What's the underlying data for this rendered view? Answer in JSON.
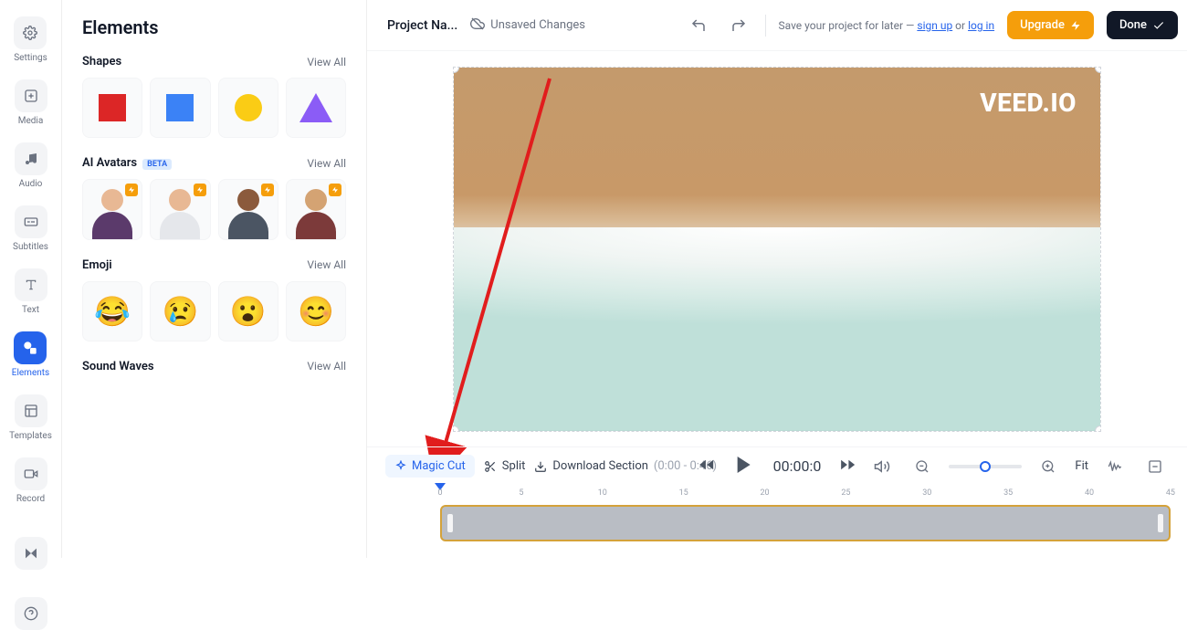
{
  "rail": {
    "items": [
      {
        "id": "settings",
        "label": "Settings"
      },
      {
        "id": "media",
        "label": "Media"
      },
      {
        "id": "audio",
        "label": "Audio"
      },
      {
        "id": "subtitles",
        "label": "Subtitles"
      },
      {
        "id": "text",
        "label": "Text"
      },
      {
        "id": "elements",
        "label": "Elements"
      },
      {
        "id": "templates",
        "label": "Templates"
      },
      {
        "id": "record",
        "label": "Record"
      }
    ]
  },
  "panel": {
    "title": "Elements",
    "view_all": "View All",
    "sections": {
      "shapes": {
        "title": "Shapes",
        "items": [
          {
            "id": "square",
            "color": "#dc2626"
          },
          {
            "id": "square2",
            "color": "#3b82f6"
          },
          {
            "id": "circle",
            "color": "#facc15"
          },
          {
            "id": "triangle",
            "color": "#8b5cf6"
          }
        ]
      },
      "avatars": {
        "title": "AI Avatars",
        "beta": "BETA",
        "items": [
          {
            "id": "avatar-1",
            "skin": "#e8b894",
            "shirt": "#5b3a6b",
            "bg": "#f3f4f6"
          },
          {
            "id": "avatar-2",
            "skin": "#e8b894",
            "shirt": "#e5e7eb",
            "bg": "#f3f4f6"
          },
          {
            "id": "avatar-3",
            "skin": "#8b5a3c",
            "shirt": "#4b5563",
            "bg": "#f3f4f6"
          },
          {
            "id": "avatar-4",
            "skin": "#d4a373",
            "shirt": "#7c3a3a",
            "bg": "#f3f4f6"
          }
        ]
      },
      "emoji": {
        "title": "Emoji",
        "items": [
          {
            "id": "joy",
            "char": "😂"
          },
          {
            "id": "cry",
            "char": "😢"
          },
          {
            "id": "wow",
            "char": "😮"
          },
          {
            "id": "blush",
            "char": "😊"
          }
        ]
      },
      "soundwaves": {
        "title": "Sound Waves"
      }
    }
  },
  "topbar": {
    "project_name": "Project Na...",
    "unsaved": "Unsaved Changes",
    "save_prefix": "Save your project for later — ",
    "signup": "sign up",
    "or": " or ",
    "login": "log in",
    "upgrade": "Upgrade",
    "done": "Done"
  },
  "canvas": {
    "watermark": "VEED.IO"
  },
  "playbar": {
    "magic_cut": "Magic Cut",
    "split": "Split",
    "download": "Download Section",
    "download_range": "(0:00 - 0:46)",
    "timecode": "00:00:0",
    "fit": "Fit"
  },
  "timeline": {
    "ticks": [
      "0",
      "5",
      "10",
      "15",
      "20",
      "25",
      "30",
      "35",
      "40",
      "45"
    ]
  }
}
